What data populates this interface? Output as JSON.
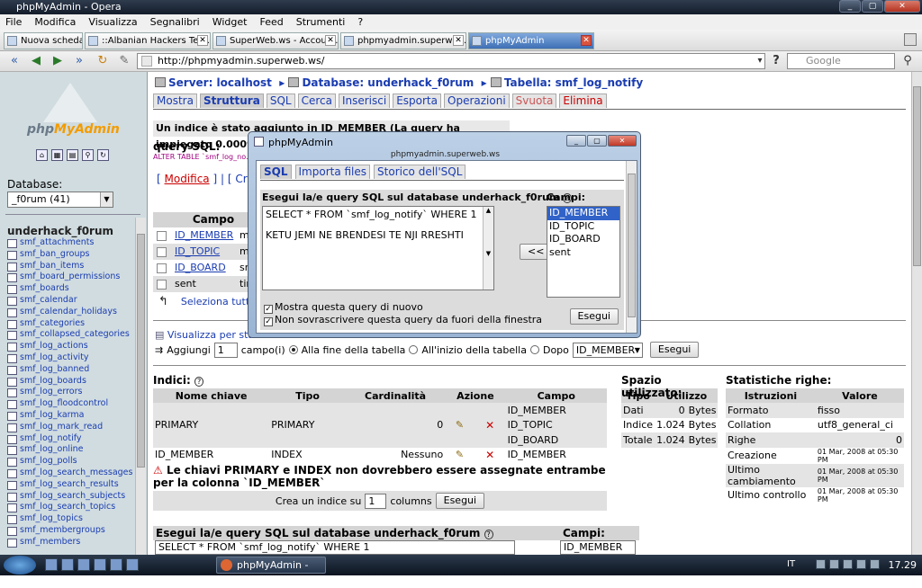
{
  "window": {
    "title": "phpMyAdmin - Opera",
    "buttons": [
      "_",
      "▢",
      "✕"
    ]
  },
  "menu": [
    "File",
    "Modifica",
    "Visualizza",
    "Segnalibri",
    "Widget",
    "Feed",
    "Strumenti",
    "?"
  ],
  "tabs": [
    {
      "label": "Nuova scheda"
    },
    {
      "label": "::Albanian Hackers Tea..."
    },
    {
      "label": "SuperWeb.ws - Accoun..."
    },
    {
      "label": "phpmyadmin.superwe..."
    },
    {
      "label": "phpMyAdmin"
    }
  ],
  "address": {
    "url": "http://phpmyadmin.superweb.ws/",
    "search_placeholder": "Google"
  },
  "sidebar": {
    "logo_text_a": "php",
    "logo_text_b": "MyAdmin",
    "db_label": "Database:",
    "db_selected": "_f0rum (41)",
    "db_name": "underhack_f0rum",
    "tables": [
      "smf_attachments",
      "smf_ban_groups",
      "smf_ban_items",
      "smf_board_permissions",
      "smf_boards",
      "smf_calendar",
      "smf_calendar_holidays",
      "smf_categories",
      "smf_collapsed_categories",
      "smf_log_actions",
      "smf_log_activity",
      "smf_log_banned",
      "smf_log_boards",
      "smf_log_errors",
      "smf_log_floodcontrol",
      "smf_log_karma",
      "smf_log_mark_read",
      "smf_log_notify",
      "smf_log_online",
      "smf_log_polls",
      "smf_log_search_messages",
      "smf_log_search_results",
      "smf_log_search_subjects",
      "smf_log_search_topics",
      "smf_log_topics",
      "smf_membergroups",
      "smf_members"
    ]
  },
  "breadcrumb": {
    "server": "Server: localhost",
    "database": "Database: underhack_f0rum",
    "table": "Tabella: smf_log_notify"
  },
  "page_tabs": [
    "Mostra",
    "Struttura",
    "SQL",
    "Cerca",
    "Inserisci",
    "Esporta",
    "Operazioni",
    "Svuota",
    "Elimina"
  ],
  "notice": "Un indice è stato aggiunto in ID_MEMBER (La query ha impiegato 0.0009 sec)",
  "sql_label": "query SQL:",
  "sql_code": "ALTER TABLE `smf_log_no...",
  "modify_link": "Modifica",
  "create_link": "Crea il c",
  "field_header": "Campo",
  "fields": [
    {
      "name": "ID_MEMBER",
      "type": "m"
    },
    {
      "name": "ID_TOPIC",
      "type": "m"
    },
    {
      "name": "ID_BOARD",
      "type": "sr"
    },
    {
      "name": "sent",
      "type": "tir"
    }
  ],
  "select_all": "Seleziona tutti",
  "print_view": "Visualizza per stam",
  "add_row": {
    "label": "Aggiungi",
    "value": "1",
    "unit": "campo(i)",
    "opt1": "Alla fine della tabella",
    "opt2": "All'inizio della tabella",
    "opt3": "Dopo",
    "after_field": "ID_MEMBER",
    "button": "Esegui"
  },
  "indici": {
    "title": "Indici:",
    "headers": [
      "Nome chiave",
      "Tipo",
      "Cardinalità",
      "Azione",
      "Campo"
    ],
    "rows": [
      {
        "key": "PRIMARY",
        "type": "PRIMARY",
        "card": "0",
        "fields": [
          "ID_MEMBER",
          "ID_TOPIC",
          "ID_BOARD"
        ]
      },
      {
        "key": "ID_MEMBER",
        "type": "INDEX",
        "card": "Nessuno",
        "fields": [
          "ID_MEMBER"
        ]
      }
    ],
    "warning": "Le chiavi PRIMARY e INDEX non dovrebbero essere assegnate entrambe per la colonna `ID_MEMBER`",
    "create_label": "Crea un indice su",
    "create_value": "1",
    "create_unit": "columns",
    "create_button": "Esegui"
  },
  "spazio": {
    "title": "Spazio utilizzato:",
    "headers": [
      "Tipo",
      "Utilizzo"
    ],
    "rows": [
      {
        "k": "Dati",
        "v": "0",
        "u": "Bytes"
      },
      {
        "k": "Indice",
        "v": "1.024",
        "u": "Bytes"
      },
      {
        "k": "Totale",
        "v": "1.024",
        "u": "Bytes"
      }
    ]
  },
  "stats": {
    "title": "Statistiche righe:",
    "headers": [
      "Istruzioni",
      "Valore"
    ],
    "rows": [
      {
        "k": "Formato",
        "v": "fisso"
      },
      {
        "k": "Collation",
        "v": "utf8_general_ci"
      },
      {
        "k": "Righe",
        "v": "0"
      },
      {
        "k": "Creazione",
        "v": "01 Mar, 2008 at 05:30 PM"
      },
      {
        "k": "Ultimo cambiamento",
        "v": "01 Mar, 2008 at 05:30 PM"
      },
      {
        "k": "Ultimo controllo",
        "v": "01 Mar, 2008 at 05:30 PM"
      }
    ]
  },
  "bottom": {
    "sql_title": "Esegui la/e query SQL sul database underhack_f0rum",
    "sql_value": "SELECT * FROM `smf_log_notify` WHERE 1",
    "campi": "Campi:",
    "campo": "ID_MEMBER"
  },
  "popup": {
    "title": "phpMyAdmin",
    "host": "phpmyadmin.superweb.ws",
    "tabs": [
      "SQL",
      "Importa files",
      "Storico dell'SQL"
    ],
    "query_title": "Esegui la/e query SQL sul database underhack_f0rum",
    "query_line1": "SELECT * FROM `smf_log_notify` WHERE 1",
    "query_line2": "KETU JEMI NE BRENDESI TE NJI RRESHTI",
    "arrow_button": "<<",
    "campi_title": "Campi:",
    "campi": [
      "ID_MEMBER",
      "ID_TOPIC",
      "ID_BOARD",
      "sent"
    ],
    "check1": "Mostra questa query di nuovo",
    "check2": "Non sovrascrivere questa query da fuori della finestra",
    "button": "Esegui"
  },
  "taskbar": {
    "task": "phpMyAdmin - Ope...",
    "lang": "IT",
    "clock": "17.29"
  }
}
